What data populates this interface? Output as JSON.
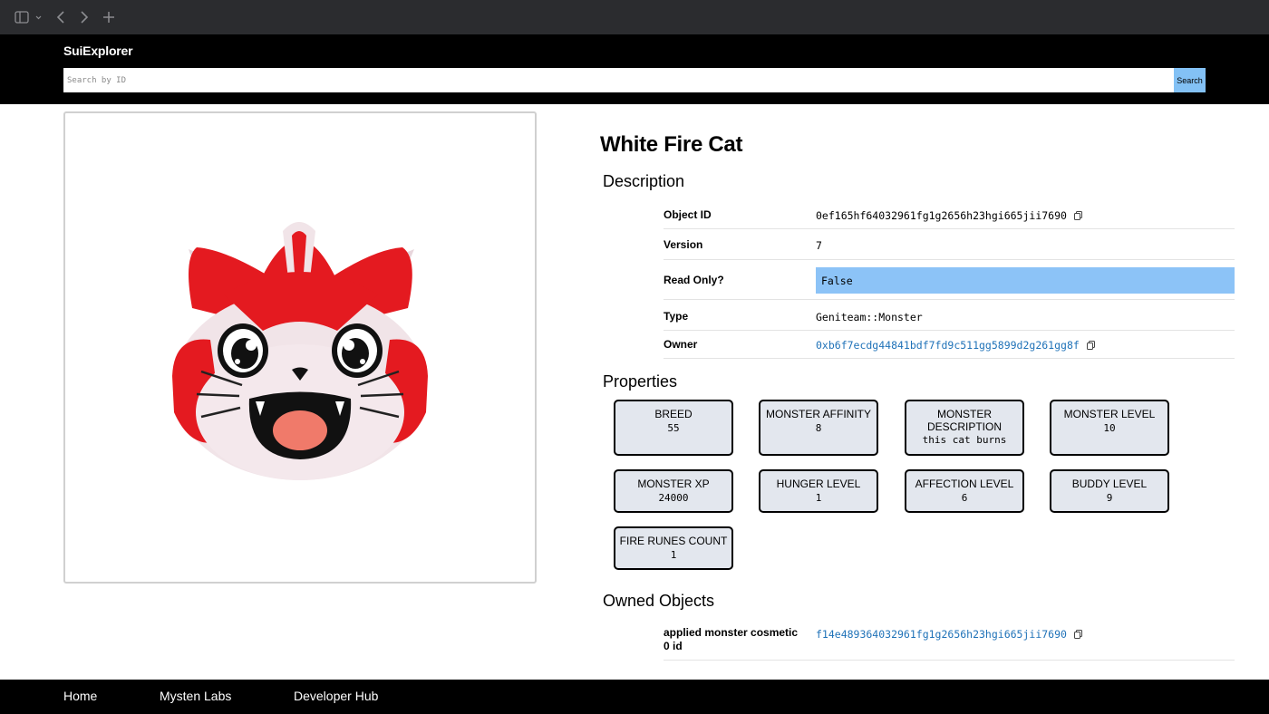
{
  "app": {
    "brand": "SuiExplorer"
  },
  "search": {
    "placeholder": "Search by ID",
    "button_label": "Search"
  },
  "object": {
    "title": "White Fire Cat",
    "description_heading": "Description",
    "fields": {
      "object_id": {
        "label": "Object ID",
        "value": "0ef165hf64032961fg1g2656h23hgi665jii7690"
      },
      "version": {
        "label": "Version",
        "value": "7"
      },
      "read_only": {
        "label": "Read Only?",
        "value": "False"
      },
      "type": {
        "label": "Type",
        "value": "Geniteam::Monster"
      },
      "owner": {
        "label": "Owner",
        "value": "0xb6f7ecdg44841bdf7fd9c511gg5899d2g261gg8f"
      }
    },
    "properties_heading": "Properties",
    "properties": [
      {
        "key": "BREED",
        "value": "55"
      },
      {
        "key": "MONSTER AFFINITY",
        "value": "8"
      },
      {
        "key": "MONSTER DESCRIPTION",
        "value": "this cat burns"
      },
      {
        "key": "MONSTER LEVEL",
        "value": "10"
      },
      {
        "key": "MONSTER XP",
        "value": "24000"
      },
      {
        "key": "HUNGER LEVEL",
        "value": "1"
      },
      {
        "key": "AFFECTION LEVEL",
        "value": "6"
      },
      {
        "key": "BUDDY LEVEL",
        "value": "9"
      },
      {
        "key": "FIRE RUNES COUNT",
        "value": "1"
      }
    ],
    "owned_heading": "Owned Objects",
    "owned_objects": [
      {
        "label": "applied monster cosmetic 0 id",
        "value": "f14e489364032961fg1g2656h23hgi665jii7690"
      }
    ]
  },
  "footer": {
    "links": [
      "Home",
      "Mysten Labs",
      "Developer Hub"
    ]
  },
  "colors": {
    "accent": "#83c1f5",
    "link": "#1f72b8",
    "read_only_bg": "#8cc3f7",
    "property_bg": "#e3e7ee"
  }
}
